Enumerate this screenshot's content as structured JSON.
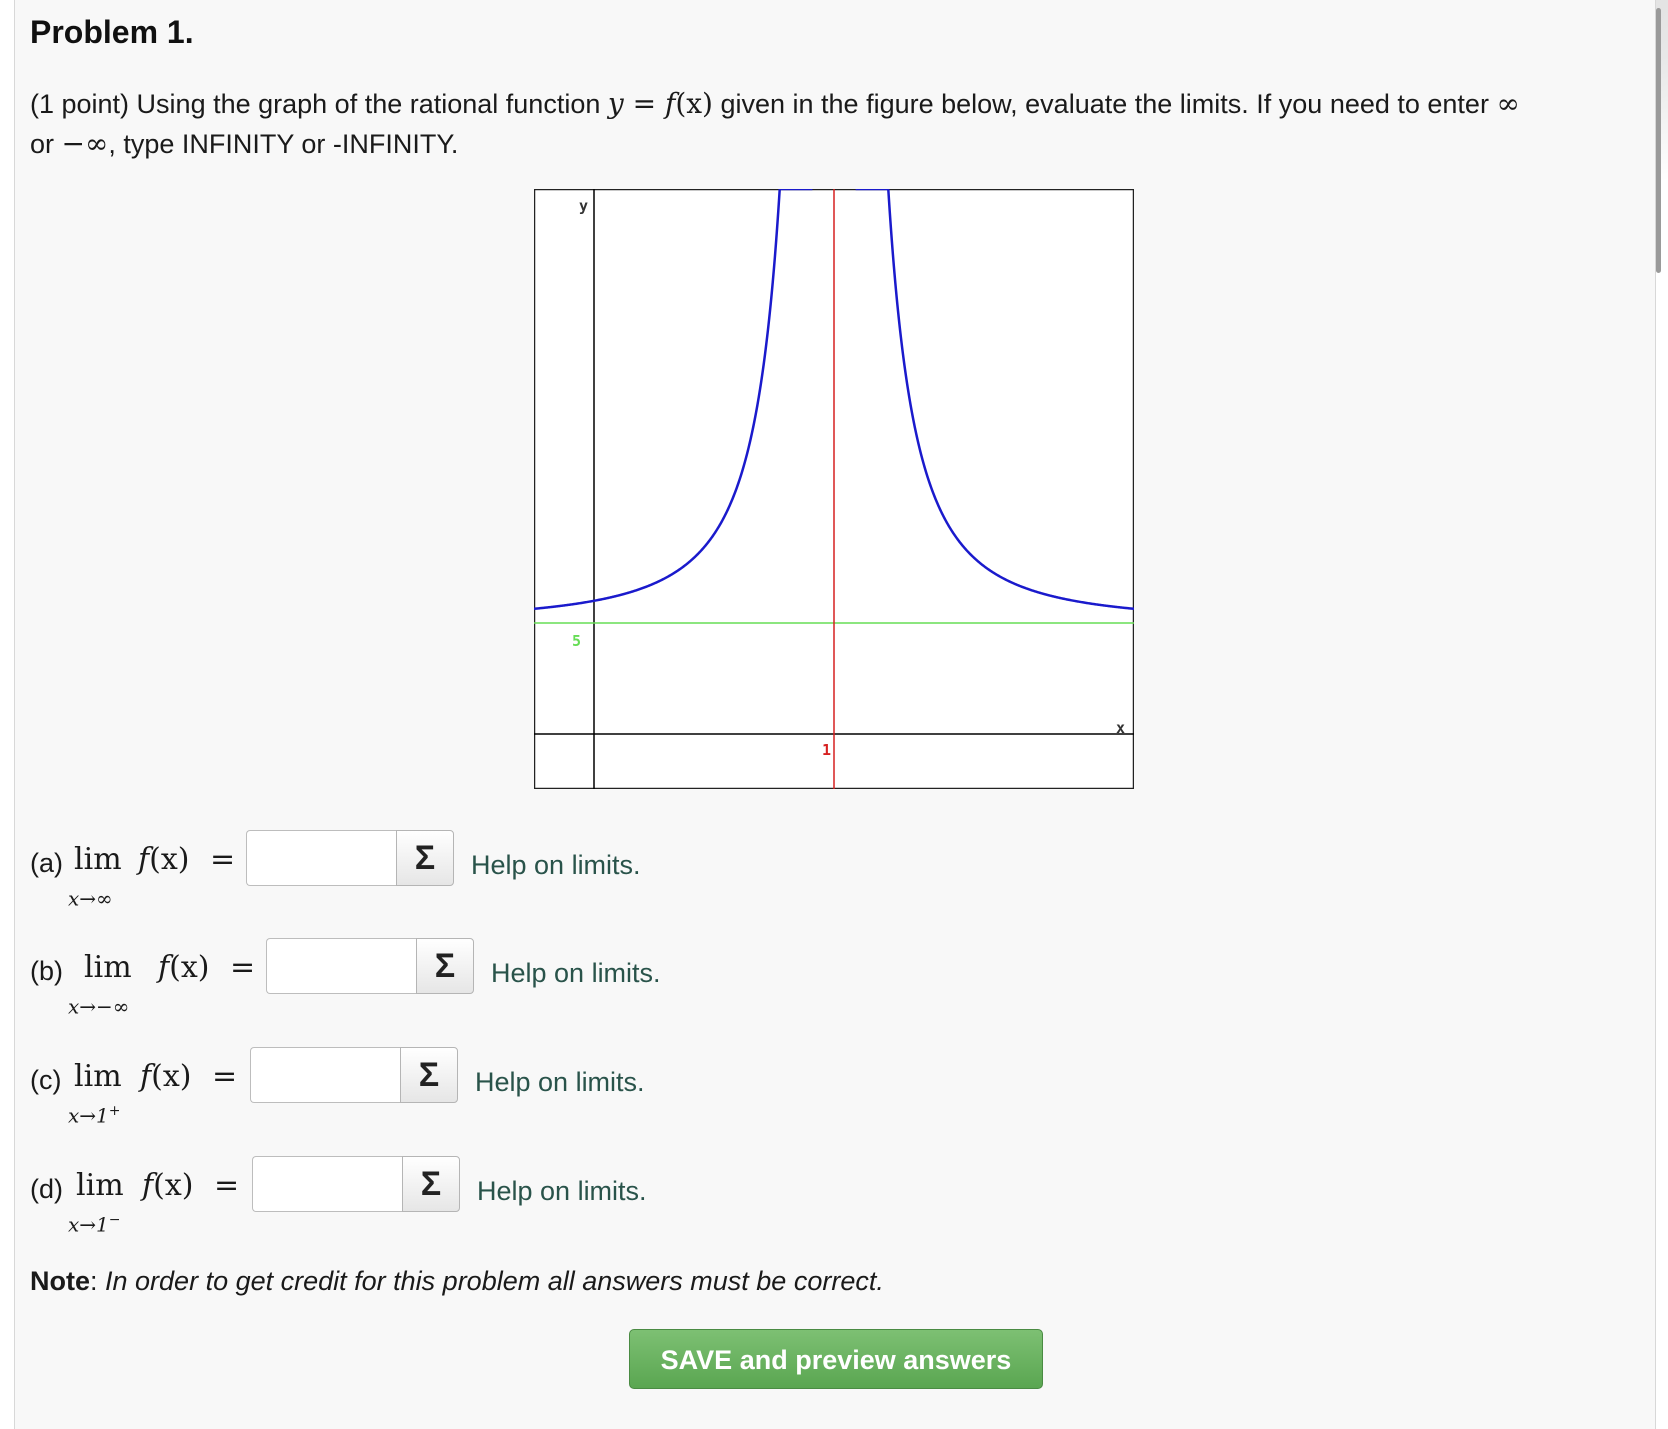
{
  "problem": {
    "title": "Problem 1.",
    "intro_prefix": "(1 point) Using the graph of the rational function ",
    "intro_math_y": "y",
    "intro_math_eq": " = ",
    "intro_math_f": "f",
    "intro_math_x": "(x)",
    "intro_middle": " given in the figure below, evaluate the limits. If you need to enter ",
    "infinity_symbol": "∞",
    "or_text": "or ",
    "neg_infinity_symbol": "−∞",
    "intro_suffix": ", type INFINITY or -INFINITY."
  },
  "graph": {
    "axis_label_y": "y",
    "axis_label_x": "x",
    "asymptote_horizontal_label": "5",
    "asymptote_vertical_label": "1",
    "colors": {
      "curve": "#1a1acc",
      "vertical_asymptote": "#d62020",
      "horizontal_asymptote": "#66dd55",
      "axes": "#000000"
    }
  },
  "chart_data": {
    "type": "line",
    "title": "",
    "xlabel": "x",
    "ylabel": "y",
    "vertical_asymptote": 1,
    "horizontal_asymptote": 5,
    "tick_labels": [
      "5",
      "1"
    ],
    "grid": false
  },
  "parts": [
    {
      "label": "(a)",
      "lim": "lim",
      "sub": "x→∞",
      "sup": "",
      "fx": "f",
      "arg": "(x)",
      "eq": "=",
      "value": "",
      "sigma": "Σ",
      "help": "Help on limits."
    },
    {
      "label": "(b)",
      "lim": "lim",
      "sub": "x→−∞",
      "sup": "",
      "fx": "f",
      "arg": "(x)",
      "eq": "=",
      "value": "",
      "sigma": "Σ",
      "help": "Help on limits."
    },
    {
      "label": "(c)",
      "lim": "lim",
      "sub": "x→1",
      "sup": "+",
      "fx": "f",
      "arg": "(x)",
      "eq": "=",
      "value": "",
      "sigma": "Σ",
      "help": "Help on limits."
    },
    {
      "label": "(d)",
      "lim": "lim",
      "sub": "x→1",
      "sup": "−",
      "fx": "f",
      "arg": "(x)",
      "eq": "=",
      "value": "",
      "sigma": "Σ",
      "help": "Help on limits."
    }
  ],
  "note": {
    "bold": "Note",
    "colon": ": ",
    "italic": "In order to get credit for this problem all answers must be correct."
  },
  "save_button": "SAVE and preview answers"
}
